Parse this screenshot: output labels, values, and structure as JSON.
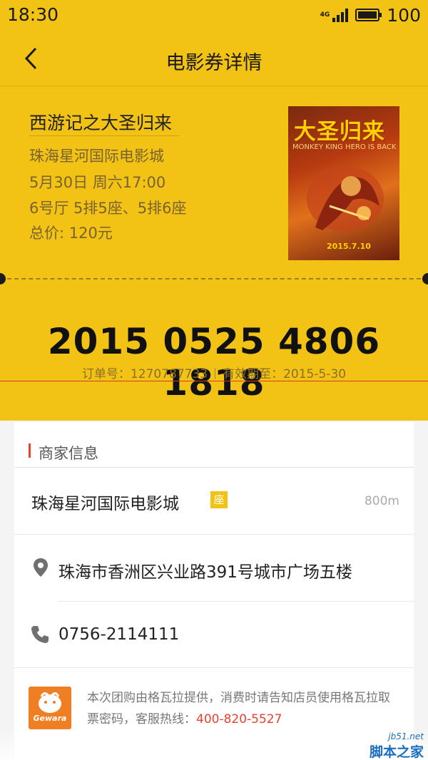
{
  "status_bar": {
    "time": "18:30",
    "network": "4G",
    "battery_level": 100,
    "battery_text": "100"
  },
  "nav": {
    "title": "电影券详情"
  },
  "movie": {
    "title": "西游记之大圣归来",
    "cinema": "珠海星河国际电影城",
    "showtime": "5月30日  周六17:00",
    "seats": "6号厅  5排5座、5排6座",
    "total": "总价: 120元"
  },
  "poster": {
    "title": "大圣归来",
    "subtitle": "MONKEY KING HERO IS BACK",
    "date": "2015.7.10"
  },
  "voucher": {
    "code": "2015 0525 4806 1818",
    "order_label": "订单号：1270787733",
    "valid_label": "有效期至：2015-5-30"
  },
  "merchant": {
    "section_title": "商家信息",
    "cinema_name": "珠海星河国际电影城",
    "seat_badge": "座",
    "distance": "800m",
    "address": "珠海市香洲区兴业路391号城市广场五楼",
    "phone": "0756-2114111"
  },
  "provider": {
    "logo_text": "Gewara",
    "note_prefix": "本次团购由格瓦拉提供，消费时请告知店员使用格瓦拉取票密码，客服热线：",
    "hotline": "400-820-5527"
  },
  "watermark": {
    "site": "jb51.net",
    "name": "脚本之家"
  },
  "colors": {
    "ticket_yellow": "#f2c315",
    "accent_red": "#e8422f",
    "gewara_orange": "#f07e23"
  },
  "icons": [
    "back-arrow-icon",
    "signal-icon",
    "battery-icon",
    "location-pin-icon",
    "phone-icon"
  ]
}
